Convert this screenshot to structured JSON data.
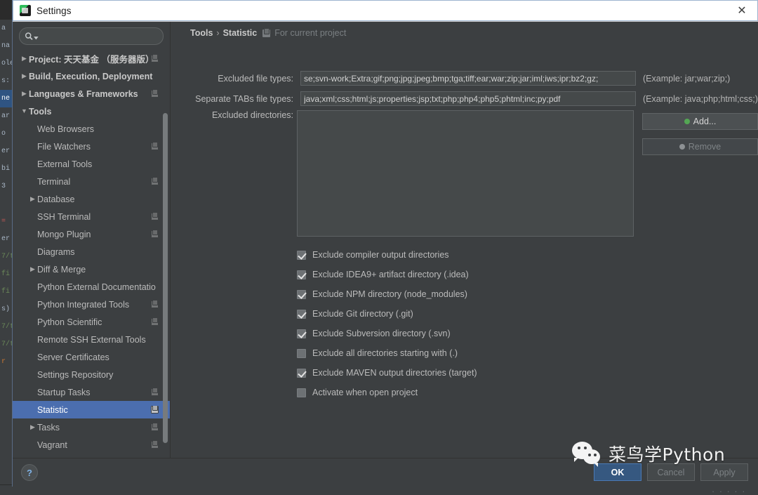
{
  "window": {
    "title": "Settings",
    "icon": "app-icon",
    "close_label": "✕"
  },
  "sidebar": {
    "search": {
      "value": "",
      "placeholder": "",
      "icon": "search-icon"
    },
    "items": [
      {
        "label": "Project: 天天基金 （服务器版）",
        "arrow": "▶",
        "bold": true,
        "badge": true,
        "indent": 0,
        "selected": false
      },
      {
        "label": "Build, Execution, Deployment",
        "arrow": "▶",
        "bold": true,
        "badge": false,
        "indent": 0,
        "selected": false
      },
      {
        "label": "Languages & Frameworks",
        "arrow": "▶",
        "bold": true,
        "badge": true,
        "indent": 0,
        "selected": false
      },
      {
        "label": "Tools",
        "arrow": "▼",
        "bold": true,
        "badge": false,
        "indent": 0,
        "selected": false
      },
      {
        "label": "Web Browsers",
        "arrow": "",
        "bold": false,
        "badge": false,
        "indent": 1,
        "selected": false
      },
      {
        "label": "File Watchers",
        "arrow": "",
        "bold": false,
        "badge": true,
        "indent": 1,
        "selected": false
      },
      {
        "label": "External Tools",
        "arrow": "",
        "bold": false,
        "badge": false,
        "indent": 1,
        "selected": false
      },
      {
        "label": "Terminal",
        "arrow": "",
        "bold": false,
        "badge": true,
        "indent": 1,
        "selected": false
      },
      {
        "label": "Database",
        "arrow": "▶",
        "bold": false,
        "badge": false,
        "indent": 1,
        "selected": false
      },
      {
        "label": "SSH Terminal",
        "arrow": "",
        "bold": false,
        "badge": true,
        "indent": 1,
        "selected": false
      },
      {
        "label": "Mongo Plugin",
        "arrow": "",
        "bold": false,
        "badge": true,
        "indent": 1,
        "selected": false
      },
      {
        "label": "Diagrams",
        "arrow": "",
        "bold": false,
        "badge": false,
        "indent": 1,
        "selected": false
      },
      {
        "label": "Diff & Merge",
        "arrow": "▶",
        "bold": false,
        "badge": false,
        "indent": 1,
        "selected": false
      },
      {
        "label": "Python External Documentatio",
        "arrow": "",
        "bold": false,
        "badge": false,
        "indent": 1,
        "selected": false
      },
      {
        "label": "Python Integrated Tools",
        "arrow": "",
        "bold": false,
        "badge": true,
        "indent": 1,
        "selected": false
      },
      {
        "label": "Python Scientific",
        "arrow": "",
        "bold": false,
        "badge": true,
        "indent": 1,
        "selected": false
      },
      {
        "label": "Remote SSH External Tools",
        "arrow": "",
        "bold": false,
        "badge": false,
        "indent": 1,
        "selected": false
      },
      {
        "label": "Server Certificates",
        "arrow": "",
        "bold": false,
        "badge": false,
        "indent": 1,
        "selected": false
      },
      {
        "label": "Settings Repository",
        "arrow": "",
        "bold": false,
        "badge": false,
        "indent": 1,
        "selected": false
      },
      {
        "label": "Startup Tasks",
        "arrow": "",
        "bold": false,
        "badge": true,
        "indent": 1,
        "selected": false
      },
      {
        "label": "Statistic",
        "arrow": "",
        "bold": false,
        "badge": true,
        "indent": 1,
        "selected": true
      },
      {
        "label": "Tasks",
        "arrow": "▶",
        "bold": false,
        "badge": true,
        "indent": 1,
        "selected": false
      },
      {
        "label": "Vagrant",
        "arrow": "",
        "bold": false,
        "badge": true,
        "indent": 1,
        "selected": false
      }
    ]
  },
  "content": {
    "breadcrumb": {
      "root": "Tools",
      "separator": "›",
      "leaf": "Statistic",
      "scope_icon": "project-scope-icon",
      "scope_text": "For current project"
    },
    "fields": [
      {
        "label": "Excluded file types:",
        "value": "se;svn-work;Extra;gif;png;jpg;jpeg;bmp;tga;tiff;ear;war;zip;jar;iml;iws;ipr;bz2;gz;",
        "example": "(Example: jar;war;zip;)"
      },
      {
        "label": "Separate TABs file types:",
        "value": "java;xml;css;html;js;properties;jsp;txt;php;php4;php5;phtml;inc;py;pdf",
        "example": "(Example: java;php;html;css;)"
      }
    ],
    "directories": {
      "label": "Excluded directories:",
      "value": ""
    },
    "side_buttons": [
      {
        "label": "Add...",
        "icon": "add-icon",
        "icon_color": "#54a754",
        "disabled": false
      },
      {
        "label": "Remove",
        "icon": "remove-icon",
        "icon_color": "#8d9194",
        "disabled": true
      }
    ],
    "checkboxes": [
      {
        "label": "Exclude compiler output directories",
        "checked": true
      },
      {
        "label": "Exclude IDEA9+ artifact directory (.idea)",
        "checked": true
      },
      {
        "label": "Exclude NPM directory (node_modules)",
        "checked": true
      },
      {
        "label": "Exclude Git directory (.git)",
        "checked": true
      },
      {
        "label": "Exclude Subversion directory (.svn)",
        "checked": true
      },
      {
        "label": "Exclude all directories starting with (.)",
        "checked": false
      },
      {
        "label": "Exclude MAVEN output directories (target)",
        "checked": true
      },
      {
        "label": "Activate when open project",
        "checked": false
      }
    ]
  },
  "footer": {
    "help_label": "?",
    "buttons": [
      {
        "label": "OK",
        "primary": true,
        "disabled": false
      },
      {
        "label": "Cancel",
        "primary": false,
        "disabled": true
      },
      {
        "label": "Apply",
        "primary": false,
        "disabled": true
      }
    ]
  },
  "watermark": {
    "text": "菜鸟学Python",
    "logo": "wechat-logo"
  },
  "background": {
    "code_lines": [
      "a",
      "na",
      "ole",
      "s:",
      "ne",
      "ar",
      "o",
      "er",
      "bi",
      "3",
      "",
      "",
      "",
      "",
      "",
      "er",
      "7/t",
      "fi",
      "fi",
      "s)",
      "7/t",
      "7/t",
      "r"
    ]
  },
  "colors": {
    "accent": "#4b6eaf",
    "primary_button": "#365880",
    "panel": "#3c3f41",
    "field": "#45494a",
    "text": "#bbbbbb"
  }
}
